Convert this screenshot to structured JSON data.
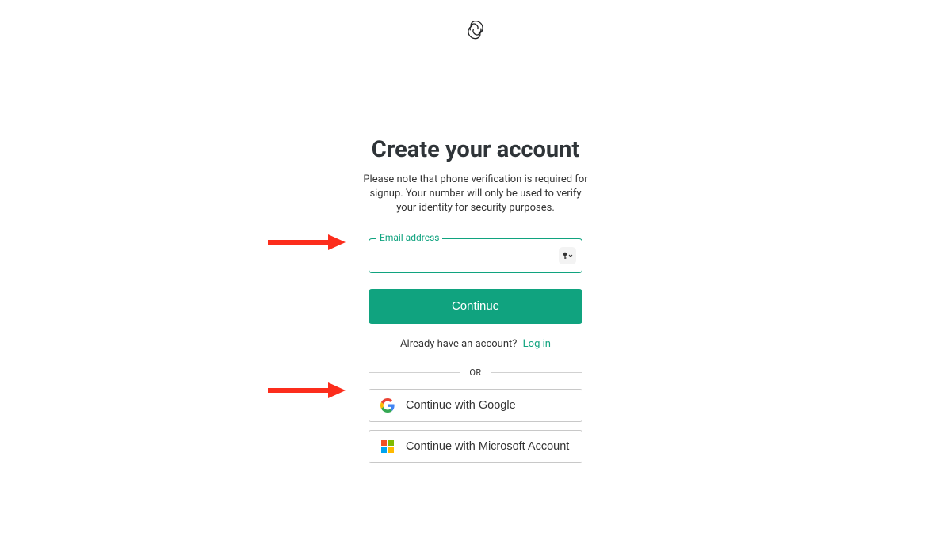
{
  "header": {
    "heading": "Create your account",
    "subtitle": "Please note that phone verification is required for signup. Your number will only be used to verify your identity for security purposes."
  },
  "form": {
    "email_label": "Email address",
    "email_value": "",
    "continue_label": "Continue"
  },
  "existing": {
    "prompt": "Already have an account?",
    "login_label": "Log in"
  },
  "divider": {
    "or": "OR"
  },
  "oauth": {
    "google_label": "Continue with Google",
    "microsoft_label": "Continue with Microsoft Account"
  },
  "colors": {
    "primary": "#10a37f",
    "annotation": "#fc2d1c"
  }
}
